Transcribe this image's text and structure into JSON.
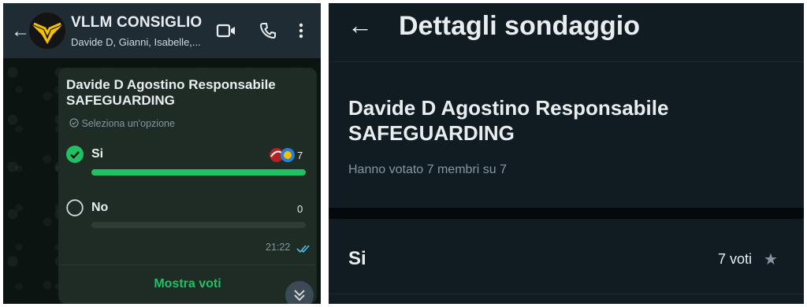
{
  "chat": {
    "back_icon": "arrow-left-icon",
    "group_name": "VLLM CONSIGLIO",
    "members": "Davide D, Gianni, Isabelle,...",
    "actions": [
      "video-call-icon",
      "phone-call-icon",
      "more-vert-icon"
    ]
  },
  "poll": {
    "question": "Davide  D Agostino Responsabile SAFEGUARDING",
    "hint": "Seleziona un'opzione",
    "options": [
      {
        "label": "Si",
        "count": "7",
        "fraction": 1.0,
        "selected": true
      },
      {
        "label": "No",
        "count": "0",
        "fraction": 0.0,
        "selected": false
      }
    ],
    "time": "21:22",
    "show_votes": "Mostra voti"
  },
  "details": {
    "title": "Dettagli sondaggio",
    "question": "Davide  D Agostino Responsabile SAFEGUARDING",
    "voted": "Hanno votato 7 membri su 7",
    "option_label": "Si",
    "option_votes": "7 voti"
  },
  "colors": {
    "accent": "#21c063",
    "header": "#1f2c33",
    "bubble": "#1e2c25",
    "panel": "#101c21",
    "read_ticks": "#53bdeb"
  }
}
